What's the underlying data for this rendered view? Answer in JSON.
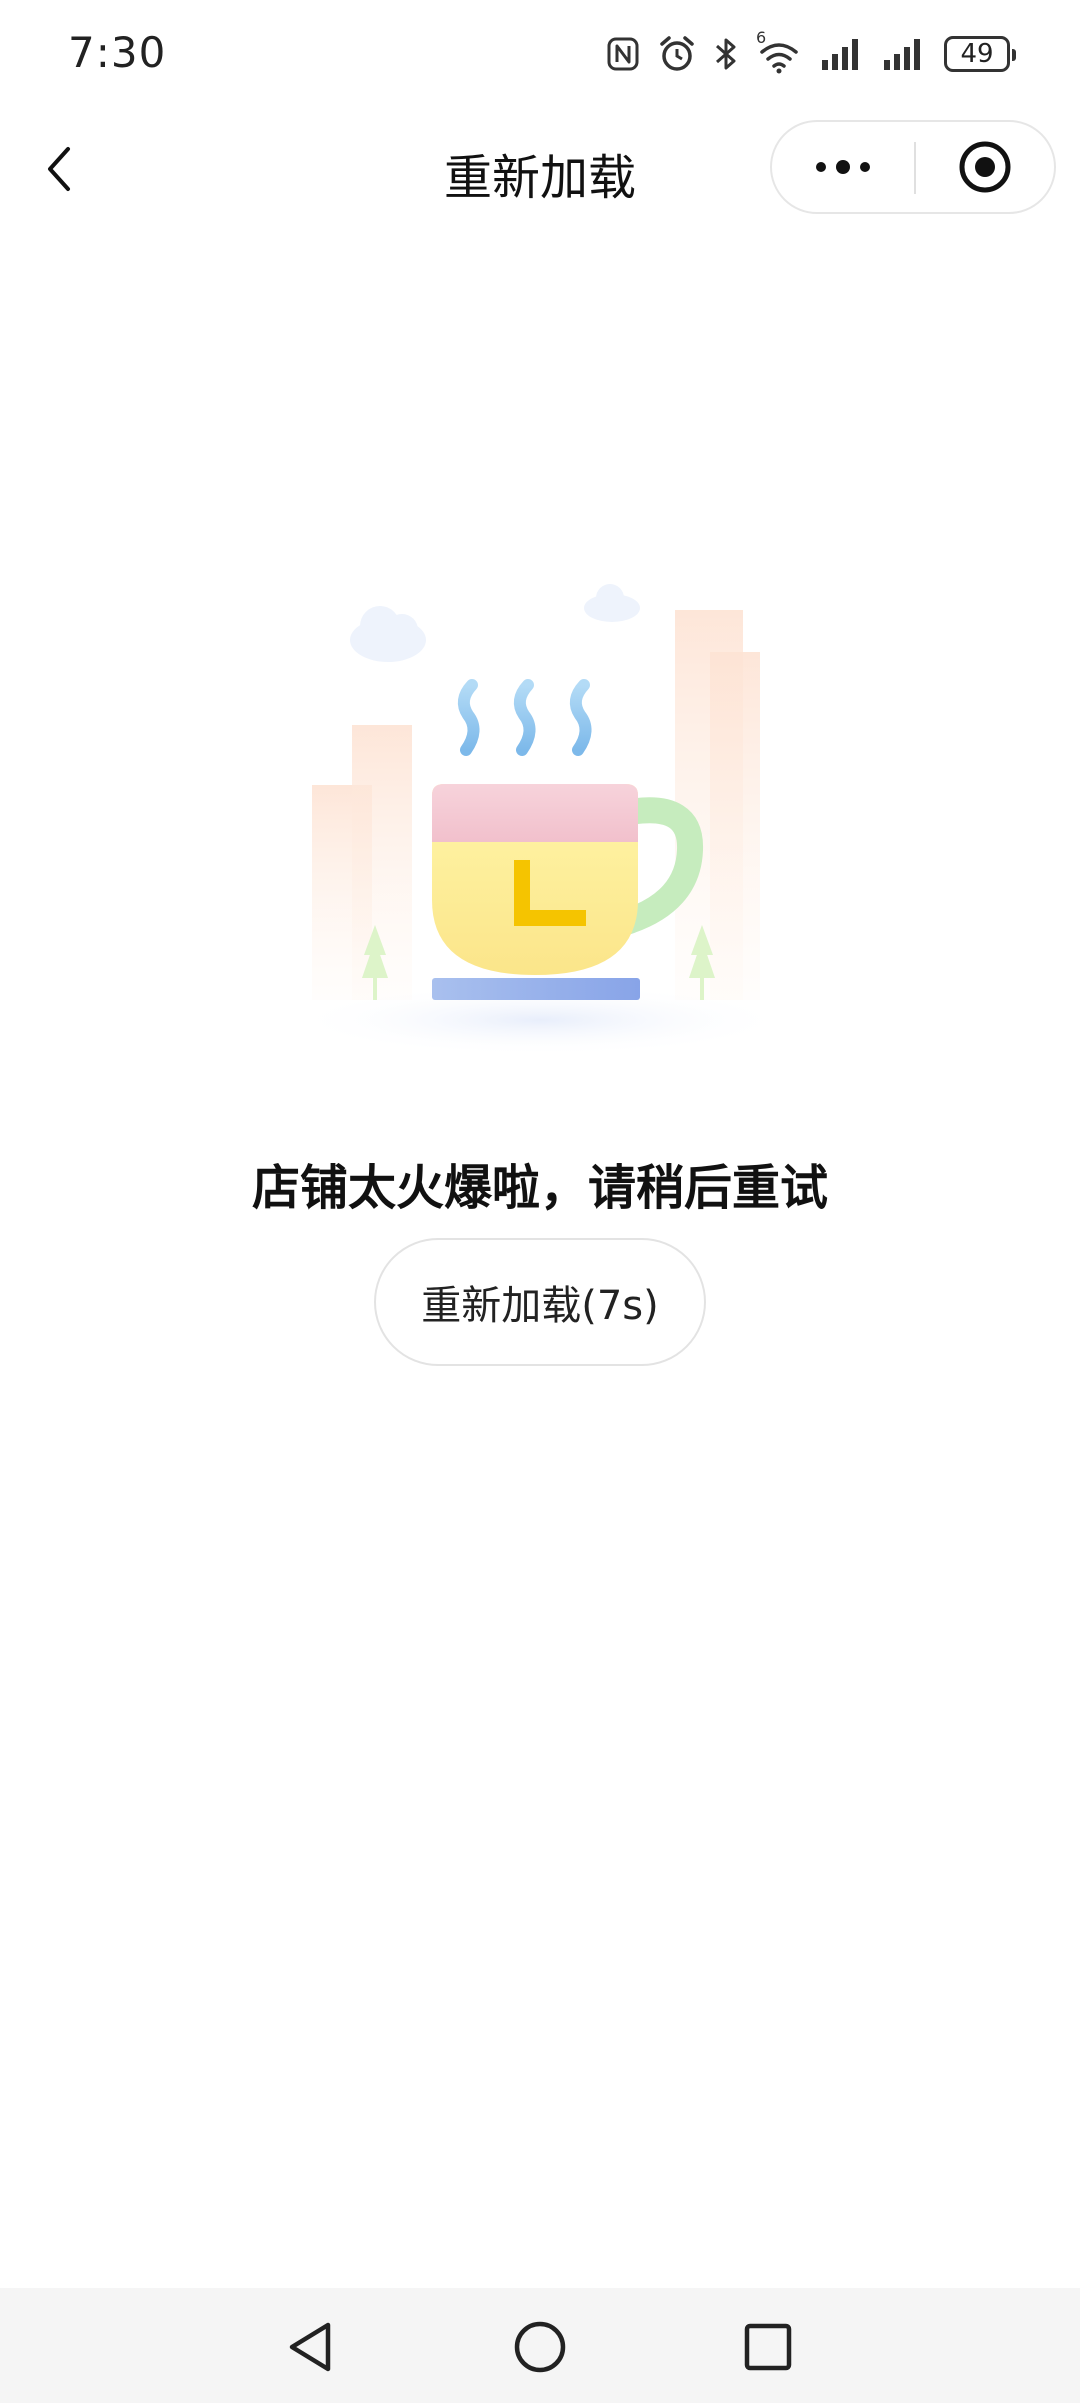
{
  "status_bar": {
    "time": "7:30",
    "battery": "49",
    "network_label": "6"
  },
  "nav": {
    "title": "重新加载"
  },
  "content": {
    "message": "店铺太火爆啦，请稍后重试",
    "reload_label": "重新加载(7s)",
    "illustration_icon": "coffee-cup-illustration",
    "cup_letter": "L"
  },
  "colors": {
    "accent_yellow": "#F5C400",
    "cup_pink": "#F2C4CF",
    "steam_blue": "#8CC2EC",
    "saucer_blue": "#8FA7E8",
    "handle_green": "#BDE8B5"
  }
}
